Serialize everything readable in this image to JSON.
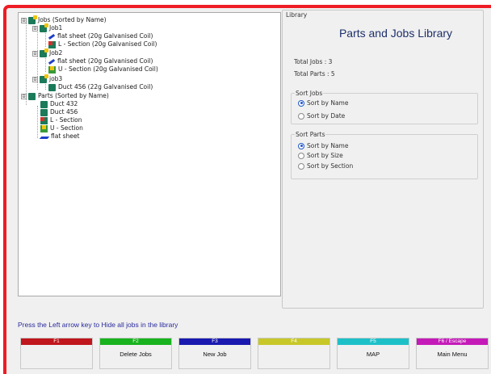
{
  "tree": {
    "jobs_root": "Jobs (Sorted by Name)",
    "jobs": [
      {
        "label": "Job1",
        "items": [
          "flat sheet (20g Galvanised Coil)",
          "L - Section (20g Galvanised Coil)"
        ]
      },
      {
        "label": "Job2",
        "items": [
          "flat sheet (20g Galvanised Coil)",
          "U - Section (20g Galvanised Coil)"
        ]
      },
      {
        "label": "job3",
        "items": [
          "Duct 456 (22g Galvanised Coil)"
        ]
      }
    ],
    "parts_root": "Parts (Sorted by Name)",
    "parts": [
      "Duct 432",
      "Duct 456",
      "L - Section",
      "U - Section",
      "flat sheet"
    ],
    "expander_minus": "⊟"
  },
  "library": {
    "label": "Library",
    "title": "Parts and Jobs Library",
    "total_jobs": "Total Jobs : 3",
    "total_parts": "Total Parts : 5",
    "sort_jobs": {
      "title": "Sort Jobs",
      "options": [
        "Sort by Name",
        "Sort by Date"
      ],
      "selected": "Sort by Name"
    },
    "sort_parts": {
      "title": "Sort Parts",
      "options": [
        "Sort by Name",
        "Sort by Size",
        "Sort by Section"
      ],
      "selected": "Sort by Name"
    }
  },
  "hint": "Press the Left arrow key to Hide all jobs in the library",
  "fkeys": [
    {
      "key": "F1",
      "label": "",
      "color": "#c0161d"
    },
    {
      "key": "F2",
      "label": "Delete Jobs",
      "color": "#18b31e"
    },
    {
      "key": "F3",
      "label": "New Job",
      "color": "#1a1ab0"
    },
    {
      "key": "F4",
      "label": "",
      "color": "#c7c72a"
    },
    {
      "key": "F5",
      "label": "MAP",
      "color": "#1ec0c8"
    },
    {
      "key": "F6 / Escape",
      "label": "Main Menu",
      "color": "#c41ab8"
    }
  ],
  "colors": {
    "frame": "#ee1c24",
    "title": "#1d2f6b",
    "hint": "#2a2a9e"
  }
}
